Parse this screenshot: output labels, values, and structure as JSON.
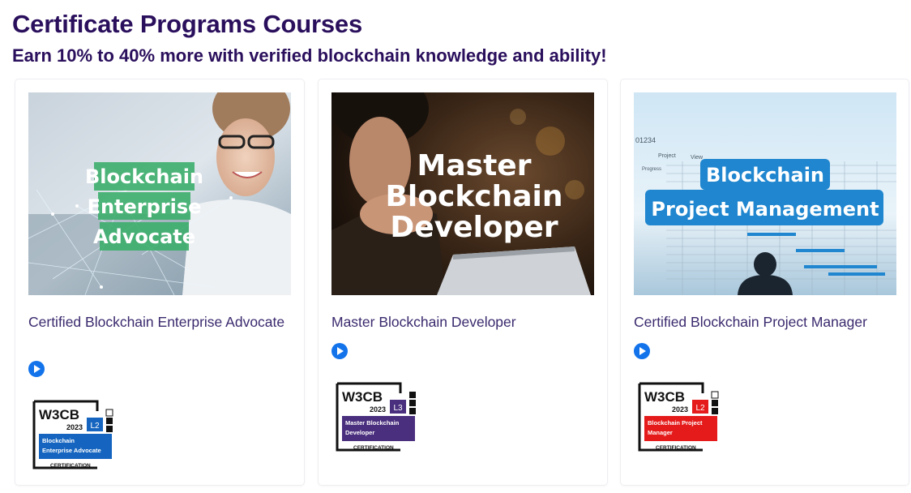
{
  "header": {
    "title": "Certificate Programs Courses",
    "subtitle": "Earn 10% to 40% more with verified blockchain knowledge and ability!"
  },
  "courses": [
    {
      "image_text": [
        "Blockchain",
        "Enterprise",
        "Advocate"
      ],
      "title": "Certified Blockchain Enterprise Advocate",
      "badge": {
        "brand": "W3CB",
        "year": "2023",
        "level": "L2",
        "name_lines": [
          "Blockchain",
          "Enterprise Advocate"
        ],
        "footer": "CERTIFICATION",
        "color": "#1565c0"
      }
    },
    {
      "image_text": [
        "Master",
        "Blockchain",
        "Developer"
      ],
      "title": "Master Blockchain Developer",
      "badge": {
        "brand": "W3CB",
        "year": "2023",
        "level": "L3",
        "name_lines": [
          "Master Blockchain",
          "Developer"
        ],
        "footer": "CERTIFICATION",
        "color": "#4a2f7e"
      }
    },
    {
      "image_text": [
        "Blockchain",
        "Project Management"
      ],
      "title": "Certified Blockchain Project Manager",
      "badge": {
        "brand": "W3CB",
        "year": "2023",
        "level": "L2",
        "name_lines": [
          "Blockchain Project",
          "Manager"
        ],
        "footer": "CERTIFICATION",
        "color": "#e51b1b"
      }
    }
  ],
  "thumb_chart_labels": {
    "code": "01234",
    "col1": "Project",
    "col2": "View",
    "row_label": "Progress"
  },
  "icons": {
    "play": "play-icon"
  },
  "colors": {
    "heading": "#2a0f5c",
    "accent": "#1273eb",
    "advocate_green": "#3cae6b",
    "pm_blue": "#1f86cf"
  }
}
